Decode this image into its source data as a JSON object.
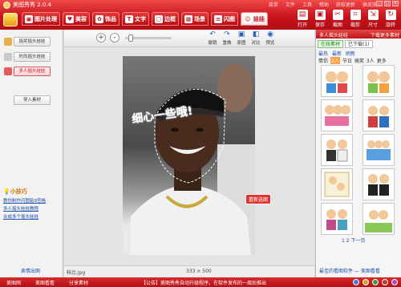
{
  "app": {
    "title": "美图秀秀 2.0.4"
  },
  "top_menu": [
    "菜单",
    "文件",
    "工具",
    "帮助",
    "获取更新",
    "换皮肤"
  ],
  "window_controls": [
    "minimize-icon",
    "maximize-icon",
    "close-icon"
  ],
  "tabs": [
    {
      "label": "图片处理",
      "icon": "image-icon",
      "active": false
    },
    {
      "label": "美容",
      "icon": "heart-icon",
      "active": false
    },
    {
      "label": "饰品",
      "icon": "flower-icon",
      "active": false
    },
    {
      "label": "文字",
      "icon": "text-icon",
      "active": false
    },
    {
      "label": "边框",
      "icon": "frame-icon",
      "active": false
    },
    {
      "label": "场景",
      "icon": "scene-icon",
      "active": false
    },
    {
      "label": "闪图",
      "icon": "flash-icon",
      "active": false
    },
    {
      "label": "娃娃",
      "icon": "doll-icon",
      "active": true
    }
  ],
  "actions": [
    {
      "label": "打开",
      "icon": "open-icon"
    },
    {
      "label": "保存",
      "icon": "save-icon"
    },
    {
      "label": "截图",
      "icon": "screenshot-icon"
    },
    {
      "label": "裁剪",
      "icon": "crop-icon"
    },
    {
      "label": "尺寸",
      "icon": "resize-icon"
    },
    {
      "label": "旋转",
      "icon": "rotate-icon"
    }
  ],
  "left_panel": {
    "buttons": [
      {
        "label": "摇奖摇头娃娃",
        "selected": false
      },
      {
        "label": "时尚摇头娃娃",
        "selected": false
      },
      {
        "label": "多人摇头娃娃",
        "selected": true
      }
    ],
    "import_label": "导入素材",
    "tips_title": "小技巧",
    "tips": [
      "教你制作闪图贴9宫格",
      "多人摇头娃娃教程",
      "合成多个摇头娃娃"
    ],
    "bottom_link": "表情出图"
  },
  "editor_toolbar": {
    "zoom_in": "+",
    "zoom_out": "-",
    "tools": [
      {
        "label": "撤销",
        "icon": "undo-icon"
      },
      {
        "label": "重做",
        "icon": "redo-icon"
      },
      {
        "label": "原图",
        "icon": "original-icon"
      },
      {
        "label": "对比",
        "icon": "compare-icon"
      },
      {
        "label": "预览",
        "icon": "preview-icon"
      }
    ]
  },
  "canvas": {
    "hint": "细心一些哦!",
    "redo_badge": "重新选图",
    "filename": "科比.jpg",
    "dimensions": "333 × 500"
  },
  "right_panel": {
    "header": "多人摇头娃娃",
    "header_link": "下载更多素材",
    "tabs": [
      {
        "label": "在线素材",
        "active": true
      },
      {
        "label": "已下载(1)",
        "active": false
      }
    ],
    "sub_links": [
      "最热",
      "最新",
      "刷新"
    ],
    "categories": [
      {
        "label": "情侣",
        "active": false
      },
      {
        "label": "2人",
        "active": true
      },
      {
        "label": "节日",
        "active": false
      },
      {
        "label": "搞笑",
        "active": false
      },
      {
        "label": "3人",
        "active": false
      },
      {
        "label": "更多",
        "active": false
      }
    ],
    "thumbnail_count": 10,
    "pager": "1 2 下一页",
    "bottom_link": "最佳的看图软件 — 美图看看"
  },
  "bottom_bar": {
    "items": [
      "美图网",
      "美图看看",
      "分享素材"
    ],
    "notice": "【公告】美图秀秀自动升级程序，在软件发布的一周后推出"
  }
}
